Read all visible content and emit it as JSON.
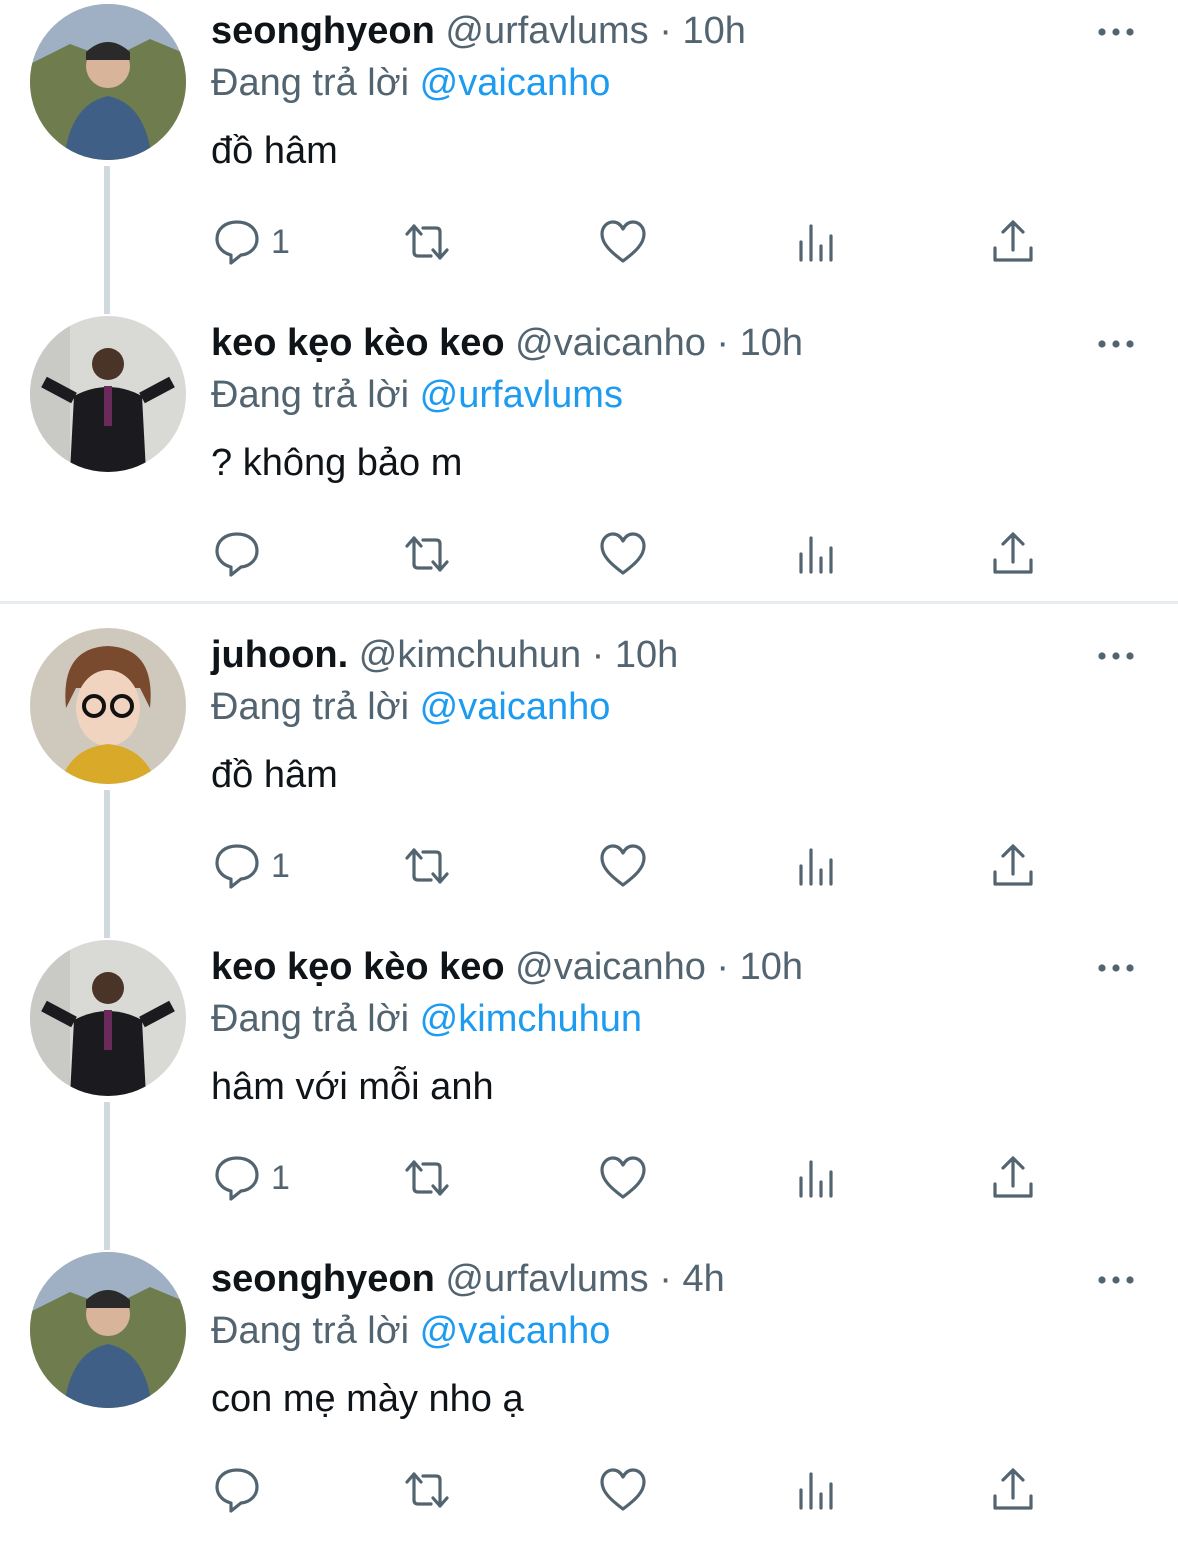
{
  "tweets": [
    {
      "name": "seonghyeon",
      "handle": "@urfavlums",
      "dot": "·",
      "time": "10h",
      "reply_prefix": "Đang trả lời",
      "reply_to": "@vaicanho",
      "text": "đồ hâm",
      "reply_count": "1",
      "avatar": "seonghyeon-avatar"
    },
    {
      "name": "keo kẹo kèo keo",
      "handle": "@vaicanho",
      "dot": "·",
      "time": "10h",
      "reply_prefix": "Đang trả lời",
      "reply_to": "@urfavlums",
      "text": "? không bảo m",
      "reply_count": "",
      "avatar": "vaicanho-avatar"
    },
    {
      "name": "juhoon.",
      "handle": "@kimchuhun",
      "dot": "·",
      "time": "10h",
      "reply_prefix": "Đang trả lời",
      "reply_to": "@vaicanho",
      "text": "đồ hâm",
      "reply_count": "1",
      "avatar": "juhoon-avatar"
    },
    {
      "name": "keo kẹo kèo keo",
      "handle": "@vaicanho",
      "dot": "·",
      "time": "10h",
      "reply_prefix": "Đang trả lời",
      "reply_to": "@kimchuhun",
      "text": "hâm với mỗi anh",
      "reply_count": "1",
      "avatar": "vaicanho-avatar"
    },
    {
      "name": "seonghyeon",
      "handle": "@urfavlums",
      "dot": "·",
      "time": "4h",
      "reply_prefix": "Đang trả lời",
      "reply_to": "@vaicanho",
      "text": "con mẹ mày nho ạ",
      "reply_count": "",
      "avatar": "seonghyeon-avatar"
    }
  ],
  "colors": {
    "text": "#0f1419",
    "secondary": "#536471",
    "accent": "#1d9bf0",
    "thread_line": "#cfd9de",
    "divider": "#e6ecf0"
  },
  "icons": [
    "reply-icon",
    "retweet-icon",
    "like-icon",
    "views-icon",
    "share-icon",
    "more-icon"
  ]
}
